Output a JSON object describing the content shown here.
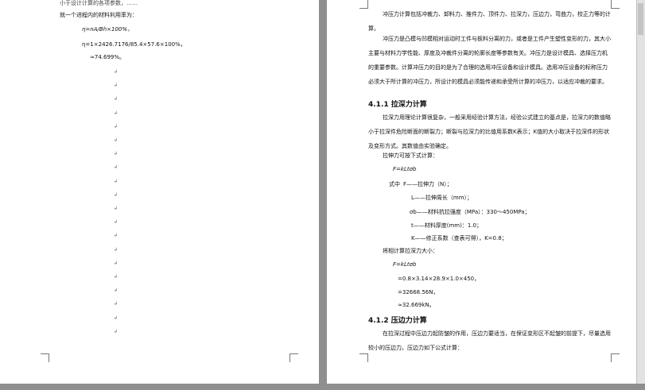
{
  "left_page": {
    "cutoff_line": "小于设计计算的各项参数，……",
    "intro": "就一个进程内的材料利用率为：",
    "formula_eta": "η=nA/Bh×100%，",
    "calc_line": "η=1×2426.7176/85.4×57.6×100%，",
    "result": "≈74.699%。",
    "para_mark": "↲"
  },
  "right_page": {
    "p1": "冲压力计算包括冲裁力、卸料力、推件力、顶件力、拉深力，压边力，弯曲力，校正力等的计算。",
    "p2": "冲压力是凸模与凹模相对运动时工件与板料分离的力，或者是工件产生塑性变形的力，其大小主要与材料力学性能、厚度及冲裁件分离的轮廓长度等参数有关。冲压力是设计模具、选择压力机的重要参数。计算冲压力的目的是为了合理的选用冲压设备和设计模具。选用冲压设备的标称压力必须大于所计算的冲压力，所设计的模具必须能传递和承受所计算的冲压力，以适应冲裁的要求。",
    "heading1": "4.1.1 拉深力计算",
    "p3": "拉深力用理论计算很复杂，一般采用经验计算方法，经验公式建立的基点是，拉深力的数值略小于拉深件危险断面的断裂力；断裂与拉深力的比值用系数K表示；K值的大小取决于拉深件的形状及变形方式。其数值由实验确定。",
    "p4": "拉伸力可按下式计算：",
    "formula1": "F=kLtσb",
    "where": "式中",
    "def_F": "F——拉伸力（N）；",
    "def_L": "L——拉伸周长（mm）；",
    "def_sigma": "σb——材料抗拉强度（MPa）：330～450MPa；",
    "def_t": "t——材料厚度(mm)：1.0；",
    "def_K": "K——修正系数（查表可得），K=0.8；",
    "p5": "将相计算拉深力大小：",
    "formula2": "F=kLtσb",
    "calc1": "=0.8×3.14×28.9×1.0×450，",
    "calc2": "=32668.56N，",
    "calc3": "≈32.669kN。",
    "heading2": "4.1.2 压边力计算",
    "p6": "在拉深过程中压边力起防皱的作用，压边力要适当，在保证变形区不起皱的前提下，尽量选用较小的压边力。压边力如下公式计算："
  }
}
